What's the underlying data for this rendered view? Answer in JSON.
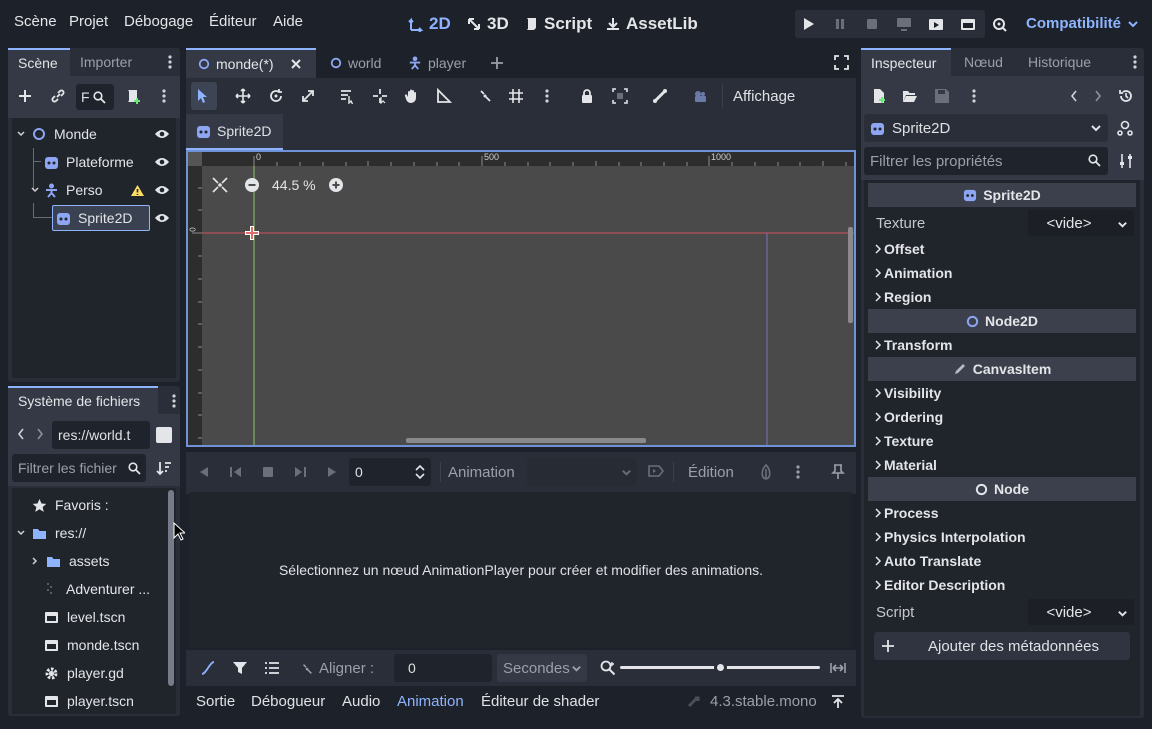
{
  "menu": [
    "Scène",
    "Projet",
    "Débogage",
    "Éditeur",
    "Aide"
  ],
  "modes": {
    "m2d": "2D",
    "m3d": "3D",
    "script": "Script",
    "assetlib": "AssetLib"
  },
  "renderer": "Compatibilité",
  "scene_panel": {
    "tabs": [
      "Scène",
      "Importer"
    ],
    "filter_text": "F",
    "tree": [
      {
        "label": "Monde"
      },
      {
        "label": "Plateforme"
      },
      {
        "label": "Perso"
      },
      {
        "label": "Sprite2D"
      }
    ]
  },
  "filesystem": {
    "title": "Système de fichiers",
    "path": "res://world.t",
    "filter_placeholder": "Filtrer les fichier",
    "items": [
      {
        "label": "Favoris :"
      },
      {
        "label": "res://"
      },
      {
        "label": "assets"
      },
      {
        "label": "Adventurer ..."
      },
      {
        "label": "level.tscn"
      },
      {
        "label": "monde.tscn"
      },
      {
        "label": "player.gd"
      },
      {
        "label": "player.tscn"
      }
    ]
  },
  "editor_tabs": [
    "monde(*)",
    "world",
    "player"
  ],
  "toolbar": {
    "view_label": "Affichage"
  },
  "canvas": {
    "node_tab": "Sprite2D",
    "zoom": "44.5 %",
    "ruler": [
      "0",
      "500",
      "1000"
    ],
    "ruler_v": "0"
  },
  "animation": {
    "time": "0",
    "label": "Animation",
    "edit": "Édition",
    "message": "Sélectionnez un nœud AnimationPlayer pour créer et modifier des animations.",
    "snap_label": "Aligner :",
    "snap_value": "0",
    "unit": "Secondes",
    "zoom_level": 0.5
  },
  "bottom_tabs": [
    "Sortie",
    "Débogueur",
    "Audio",
    "Animation",
    "Éditeur de shader"
  ],
  "version": "4.3.stable.mono",
  "inspector": {
    "tabs": [
      "Inspecteur",
      "Nœud",
      "Historique"
    ],
    "object": "Sprite2D",
    "filter_placeholder": "Filtrer les propriétés",
    "sections": {
      "sprite": "Sprite2D",
      "node2d": "Node2D",
      "canvasitem": "CanvasItem",
      "node": "Node"
    },
    "texture_label": "Texture",
    "texture_value": "<vide>",
    "sprite_groups": [
      "Offset",
      "Animation",
      "Region"
    ],
    "node2d_groups": [
      "Transform"
    ],
    "canvas_groups": [
      "Visibility",
      "Ordering",
      "Texture",
      "Material"
    ],
    "node_groups": [
      "Process",
      "Physics Interpolation",
      "Auto Translate",
      "Editor Description"
    ],
    "script_label": "Script",
    "script_value": "<vide>",
    "add_meta": "Ajouter des métadonnées"
  },
  "colors": {
    "accent": "#8eb4ff",
    "node2d": "#8da5f3",
    "warning": "#ffdd65",
    "bg": "#1d2129",
    "panel": "#2a2e38"
  }
}
